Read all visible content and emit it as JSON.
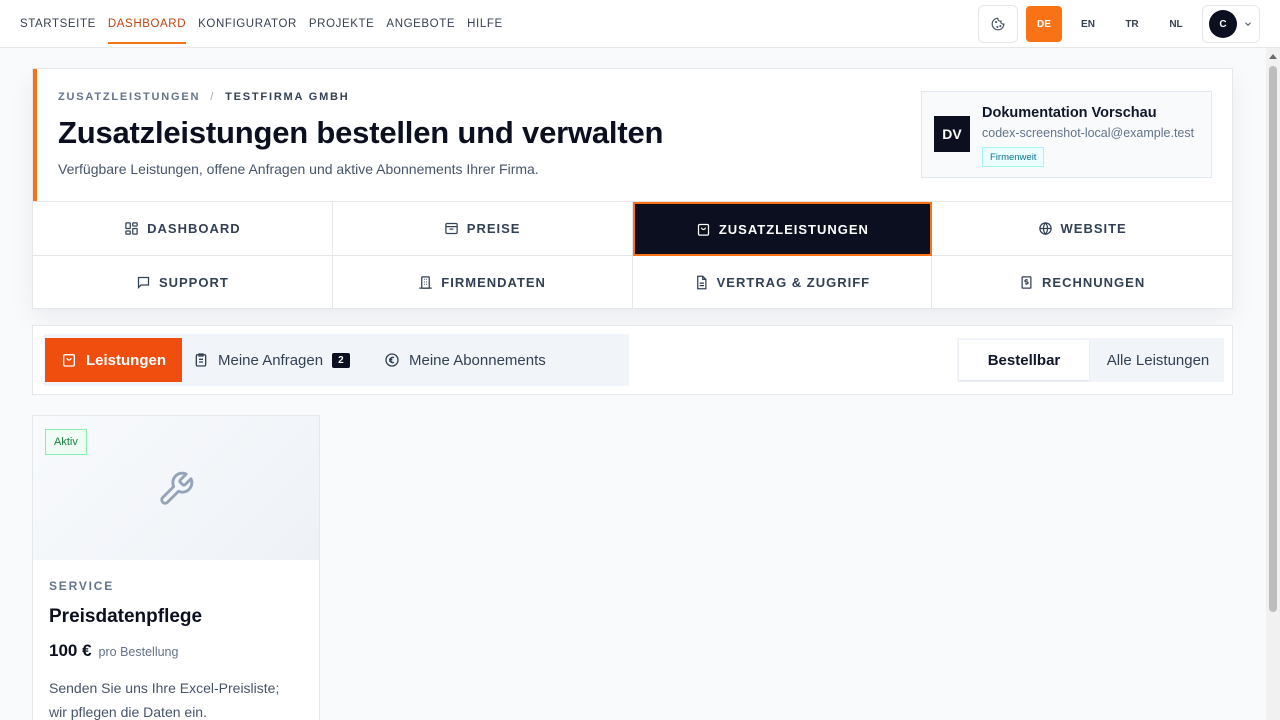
{
  "topnav": {
    "links": [
      {
        "label": "STARTSEITE",
        "active": false
      },
      {
        "label": "DASHBOARD",
        "active": true
      },
      {
        "label": "KONFIGURATOR",
        "active": false
      },
      {
        "label": "PROJEKTE",
        "active": false
      },
      {
        "label": "ANGEBOTE",
        "active": false
      },
      {
        "label": "HILFE",
        "active": false
      }
    ],
    "languages": [
      "DE",
      "EN",
      "TR",
      "NL"
    ],
    "active_language": "DE",
    "user_initial": "C"
  },
  "header": {
    "breadcrumb": [
      "ZUSATZLEISTUNGEN",
      "TESTFIRMA GMBH"
    ],
    "breadcrumb_sep": "/",
    "title": "Zusatzleistungen bestellen und verwalten",
    "subtitle": "Verfügbare Leistungen, offene Anfragen und aktive Abonnements Ihrer Firma.",
    "profile": {
      "initials": "DV",
      "name": "Dokumentation Vorschau",
      "email": "codex-screenshot-local@example.test",
      "badge": "Firmenweit"
    }
  },
  "tabs": [
    {
      "label": "DASHBOARD",
      "icon": "grid-icon",
      "active": false
    },
    {
      "label": "PREISE",
      "icon": "tag-box-icon",
      "active": false
    },
    {
      "label": "ZUSATZLEISTUNGEN",
      "icon": "shopping-bag-icon",
      "active": true
    },
    {
      "label": "WEBSITE",
      "icon": "globe-icon",
      "active": false
    },
    {
      "label": "SUPPORT",
      "icon": "chat-icon",
      "active": false
    },
    {
      "label": "FIRMENDATEN",
      "icon": "building-icon",
      "active": false
    },
    {
      "label": "VERTRAG & ZUGRIFF",
      "icon": "document-icon",
      "active": false
    },
    {
      "label": "RECHNUNGEN",
      "icon": "invoice-icon",
      "active": false
    }
  ],
  "subtabs": {
    "left": [
      {
        "label": "Leistungen",
        "active": true
      },
      {
        "label": "Meine Anfragen",
        "count": "2",
        "active": false
      },
      {
        "label": "Meine Abonnements",
        "active": false
      }
    ],
    "right": [
      {
        "label": "Bestellbar",
        "active": true
      },
      {
        "label": "Alle Leistungen",
        "active": false
      }
    ]
  },
  "products": [
    {
      "status": "Aktiv",
      "category": "SERVICE",
      "title": "Preisdatenpflege",
      "price": "100 €",
      "price_unit": "pro Bestellung",
      "description": "Senden Sie uns Ihre Excel-Preisliste; wir pflegen die Daten ein."
    }
  ],
  "colors": {
    "accent": "#f97316",
    "accent_strong": "#f04e0f",
    "dark": "#0b0f1f"
  }
}
